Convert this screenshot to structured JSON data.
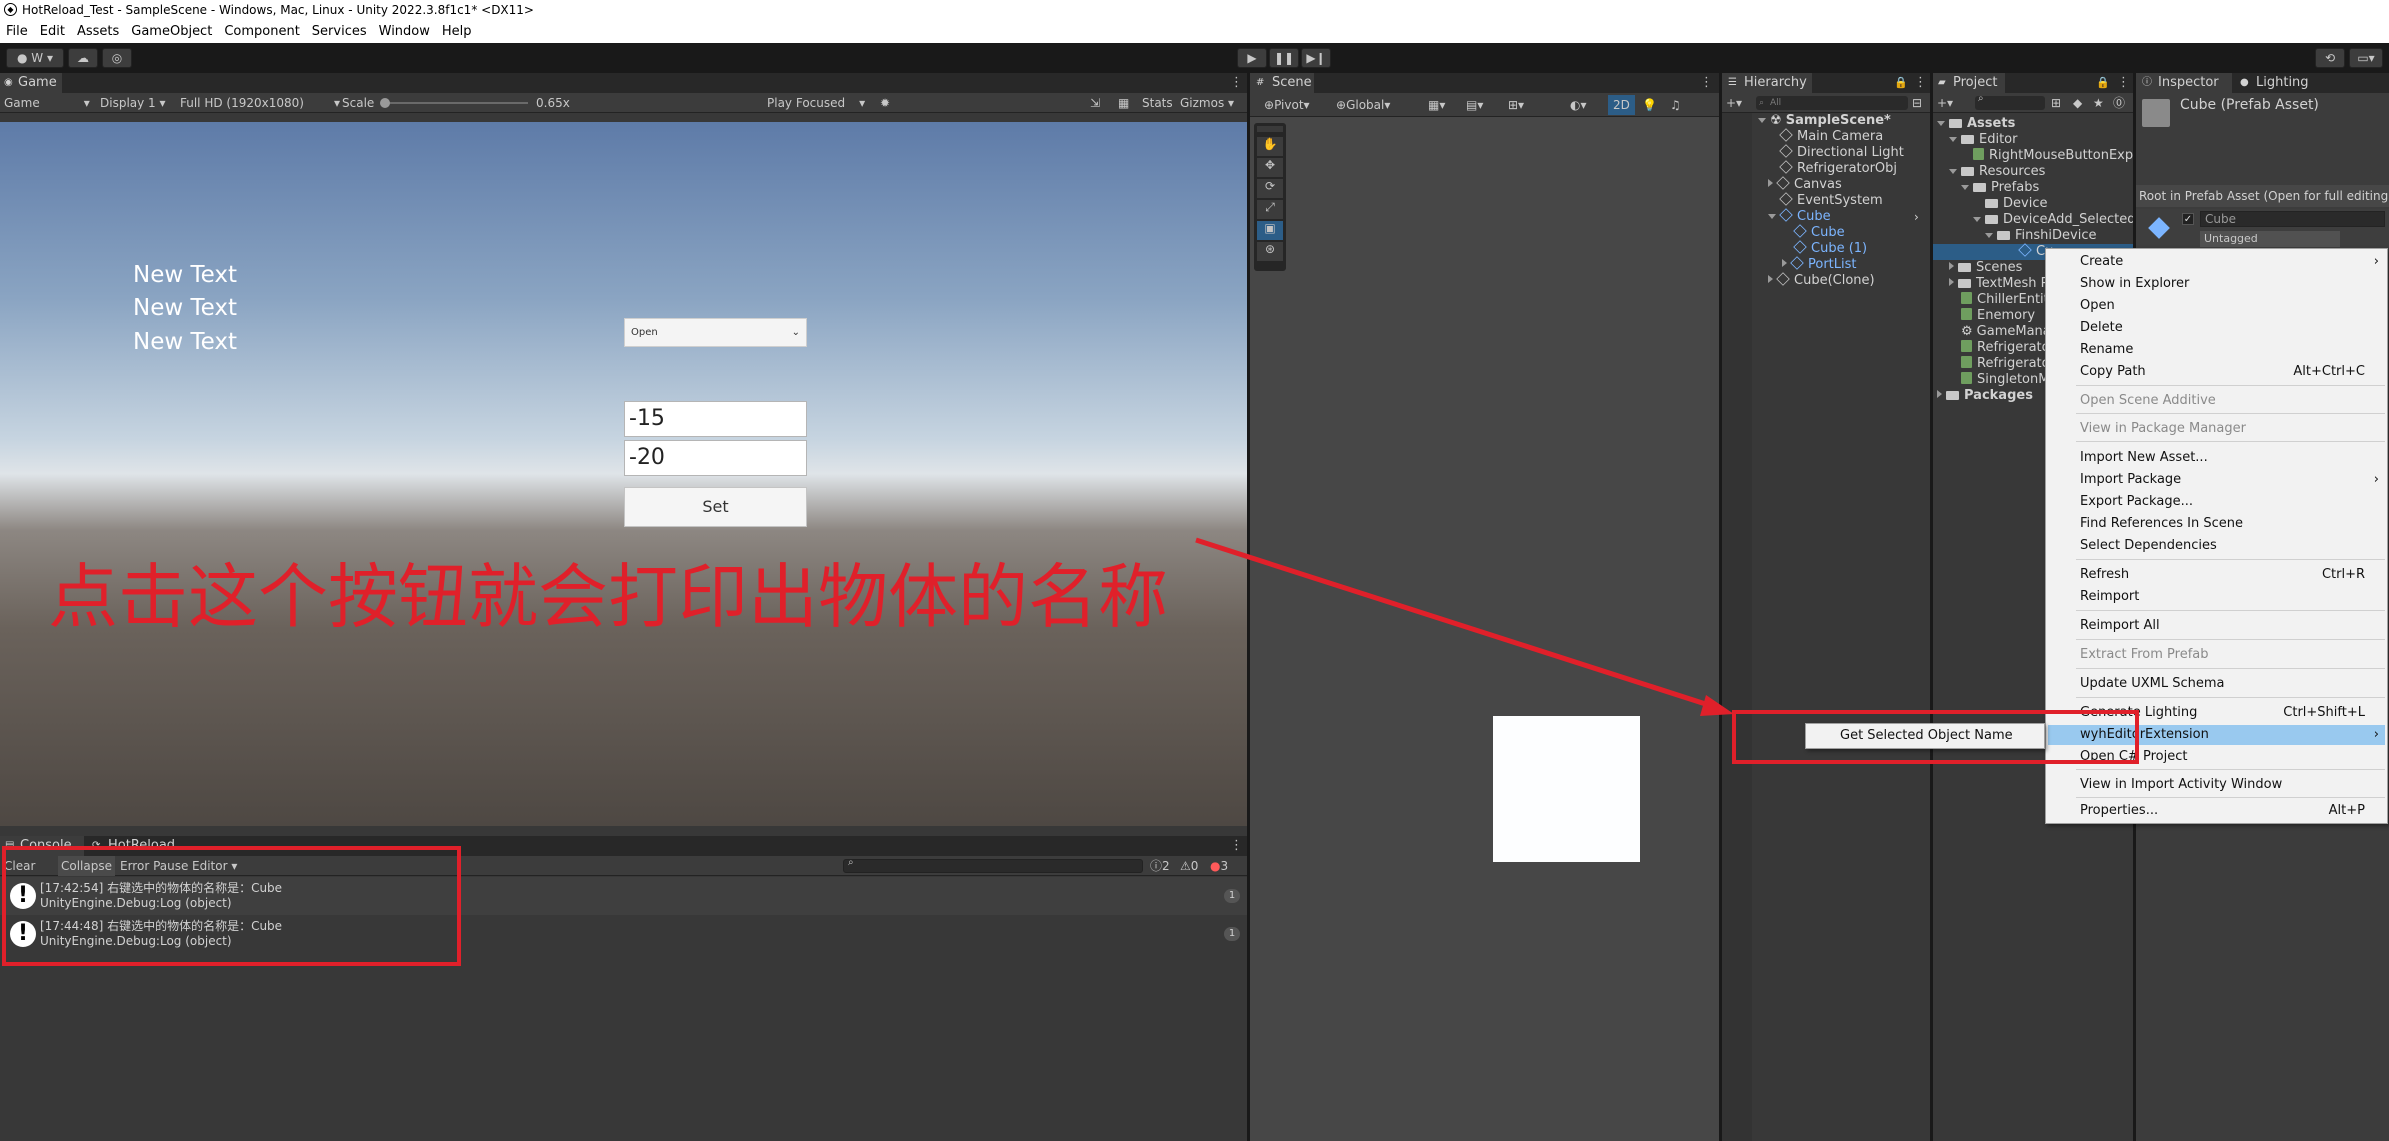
{
  "window": {
    "title": "HotReload_Test - SampleScene - Windows, Mac, Linux - Unity 2022.3.8f1c1* <DX11>"
  },
  "menubar": [
    "File",
    "Edit",
    "Assets",
    "GameObject",
    "Component",
    "Services",
    "Window",
    "Help"
  ],
  "toolbar": {
    "account_label": "W"
  },
  "game": {
    "tab": "Game",
    "view_mode": "Game",
    "display": "Display 1",
    "resolution": "Full HD (1920x1080)",
    "scale_label": "Scale",
    "scale_value": "0.65x",
    "play_mode": "Play Focused",
    "stats": "Stats",
    "gizmos": "Gizmos",
    "texts": [
      "New Text",
      "New Text",
      "New Text"
    ],
    "dropdown": "Open",
    "input1": "-15",
    "input2": "-20",
    "set_button": "Set",
    "annotation": "点击这个按钮就会打印出物体的名称"
  },
  "console": {
    "tab1": "Console",
    "tab2": "HotReload",
    "clear": "Clear",
    "collapse": "Collapse",
    "error_pause": "Error Pause",
    "editor": "Editor",
    "count_info": "2",
    "count_warn": "0",
    "count_err": "3",
    "logs": [
      {
        "line1": "[17:42:54] 右键选中的物体的名称是：Cube",
        "line2": "UnityEngine.Debug:Log (object)",
        "count": "1"
      },
      {
        "line1": "[17:44:48] 右键选中的物体的名称是：Cube",
        "line2": "UnityEngine.Debug:Log (object)",
        "count": "1"
      }
    ]
  },
  "scene": {
    "tab": "Scene",
    "pivot": "Pivot",
    "global": "Global",
    "mode_2d": "2D"
  },
  "hierarchy": {
    "tab": "Hierarchy",
    "search_placeholder": "All",
    "items": [
      "SampleScene*",
      "Main Camera",
      "Directional Light",
      "RefrigeratorObj",
      "Canvas",
      "EventSystem",
      "Cube",
      "Cube",
      "Cube (1)",
      "PortList",
      "Cube(Clone)"
    ]
  },
  "project": {
    "tab": "Project",
    "items": [
      "Assets",
      "Editor",
      "RightMouseButtonExpan",
      "Resources",
      "Prefabs",
      "Device",
      "DeviceAdd_SelectedB",
      "FinshiDevice",
      "Cu",
      "Scenes",
      "TextMesh P",
      "ChillerEntity",
      "Enemory",
      "GameManag",
      "Refrigerato",
      "Refrigerato",
      "SingletonMo",
      "Packages"
    ]
  },
  "inspector": {
    "tab": "Inspector",
    "tab2": "Lighting",
    "title": "Cube (Prefab Asset)",
    "root_text": "Root in Prefab Asset (Open for full editing sup",
    "name_field": "Cube",
    "tag_value": "Untagged"
  },
  "context_menu": {
    "items": [
      {
        "label": "Create",
        "shortcut": "",
        "disabled": false,
        "arrow": true
      },
      {
        "label": "Show in Explorer",
        "shortcut": "",
        "disabled": false
      },
      {
        "label": "Open",
        "shortcut": "",
        "disabled": false
      },
      {
        "label": "Delete",
        "shortcut": "",
        "disabled": false
      },
      {
        "label": "Rename",
        "shortcut": "",
        "disabled": false
      },
      {
        "label": "Copy Path",
        "shortcut": "Alt+Ctrl+C",
        "disabled": false
      },
      {
        "label": "Open Scene Additive",
        "shortcut": "",
        "disabled": true
      },
      {
        "label": "View in Package Manager",
        "shortcut": "",
        "disabled": true
      },
      {
        "label": "Import New Asset...",
        "shortcut": "",
        "disabled": false
      },
      {
        "label": "Import Package",
        "shortcut": "",
        "disabled": false,
        "arrow": true
      },
      {
        "label": "Export Package...",
        "shortcut": "",
        "disabled": false
      },
      {
        "label": "Find References In Scene",
        "shortcut": "",
        "disabled": false
      },
      {
        "label": "Select Dependencies",
        "shortcut": "",
        "disabled": false
      },
      {
        "label": "Refresh",
        "shortcut": "Ctrl+R",
        "disabled": false
      },
      {
        "label": "Reimport",
        "shortcut": "",
        "disabled": false
      },
      {
        "label": "Reimport All",
        "shortcut": "",
        "disabled": false
      },
      {
        "label": "Extract From Prefab",
        "shortcut": "",
        "disabled": true
      },
      {
        "label": "Update UXML Schema",
        "shortcut": "",
        "disabled": false
      },
      {
        "label": "Generate Lighting",
        "shortcut": "Ctrl+Shift+L",
        "disabled": false
      },
      {
        "label": "wyhEditorExtension",
        "shortcut": "",
        "disabled": false,
        "arrow": true,
        "highlighted": true
      },
      {
        "label": "Open C# Project",
        "shortcut": "",
        "disabled": false
      },
      {
        "label": "View in Import Activity Window",
        "shortcut": "",
        "disabled": false
      },
      {
        "label": "Properties...",
        "shortcut": "Alt+P",
        "disabled": false
      }
    ],
    "submenu_item": "Get Selected Object Name"
  },
  "colors": {
    "accent": "#2c5d87",
    "highlight": "#99c9ef",
    "annotation_red": "#e0202a"
  }
}
